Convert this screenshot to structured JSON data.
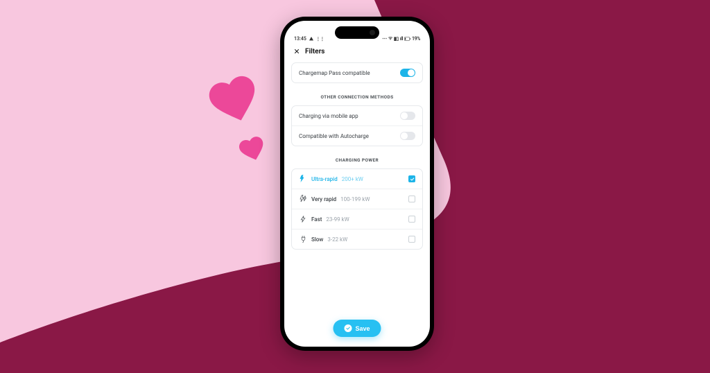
{
  "status": {
    "time": "13:45",
    "battery": "19%"
  },
  "header": {
    "title": "Filters"
  },
  "pass_compat": {
    "label": "Chargemap Pass compatible",
    "on": true
  },
  "sections": {
    "other_methods": {
      "title": "OTHER CONNECTION METHODS",
      "items": [
        {
          "label": "Charging via mobile app",
          "on": false
        },
        {
          "label": "Compatible with Autocharge",
          "on": false
        }
      ]
    },
    "charging_power": {
      "title": "CHARGING POWER",
      "options": [
        {
          "name": "Ultra-rapid",
          "range": "200+ kW",
          "checked": true
        },
        {
          "name": "Very rapid",
          "range": "100-199 kW",
          "checked": false
        },
        {
          "name": "Fast",
          "range": "23-99 kW",
          "checked": false
        },
        {
          "name": "Slow",
          "range": "3-22 kW",
          "checked": false
        }
      ]
    }
  },
  "save": {
    "label": "Save"
  },
  "colors": {
    "accent": "#1db4e8",
    "pink": "#f8c7df",
    "burgundy": "#8a1846",
    "heart": "#ec4899"
  }
}
